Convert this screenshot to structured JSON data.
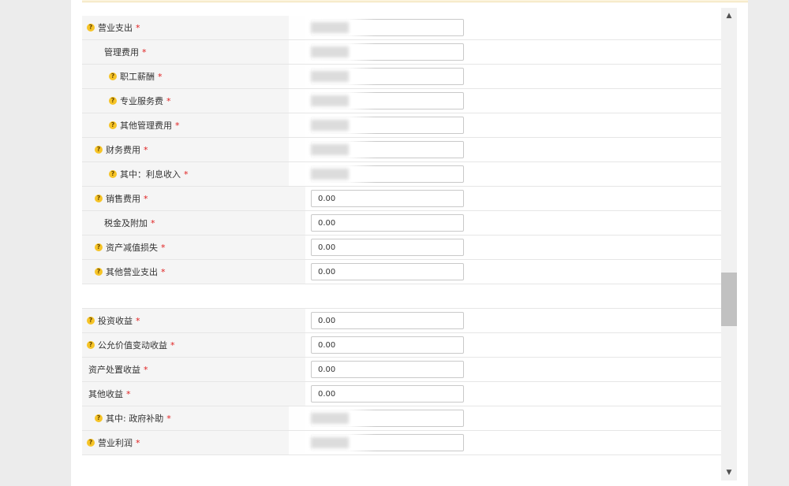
{
  "icons": {
    "help": "help-question-icon",
    "scroll_up": "scroll-up-arrow-icon",
    "scroll_down": "scroll-down-arrow-icon"
  },
  "colors": {
    "required": "#e02020",
    "help_icon": "#f6c427",
    "label_bg": "#f5f5f5"
  },
  "form": {
    "rows": [
      {
        "label": "营业支出",
        "help": true,
        "required": true,
        "indent": 0,
        "masked": true
      },
      {
        "label": "管理费用",
        "help": false,
        "required": true,
        "indent": 1,
        "masked": true
      },
      {
        "label": "职工薪酬",
        "help": true,
        "required": true,
        "indent": 2,
        "masked": true
      },
      {
        "label": "专业服务费",
        "help": true,
        "required": true,
        "indent": 2,
        "masked": true
      },
      {
        "label": "其他管理费用",
        "help": true,
        "required": true,
        "indent": 2,
        "masked": true
      },
      {
        "label": "财务费用",
        "help": true,
        "required": true,
        "indent": 1,
        "masked": true
      },
      {
        "label": "其中：利息收入",
        "help": true,
        "required": true,
        "indent": 2,
        "masked": true
      },
      {
        "label": "销售费用",
        "help": true,
        "required": true,
        "indent": 1,
        "value": "0.00"
      },
      {
        "label": "税金及附加",
        "help": false,
        "required": true,
        "indent": 1,
        "value": "0.00"
      },
      {
        "label": "资产减值损失",
        "help": true,
        "required": true,
        "indent": 1,
        "value": "0.00"
      },
      {
        "label": "其他营业支出",
        "help": true,
        "required": true,
        "indent": 1,
        "value": "0.00"
      },
      {
        "spacer": true
      },
      {
        "label": "投资收益",
        "help": true,
        "required": true,
        "indent": 0,
        "value": "0.00"
      },
      {
        "label": "公允价值变动收益",
        "help": true,
        "required": true,
        "indent": 0,
        "value": "0.00"
      },
      {
        "label": "资产处置收益",
        "help": false,
        "required": true,
        "indent": 0,
        "value": "0.00"
      },
      {
        "label": "其他收益",
        "help": false,
        "required": true,
        "indent": 0,
        "value": "0.00"
      },
      {
        "label": "其中: 政府补助",
        "help": true,
        "required": true,
        "indent": 1,
        "masked": true
      },
      {
        "label": "营业利润",
        "help": true,
        "required": true,
        "indent": 0,
        "masked": true
      }
    ]
  }
}
